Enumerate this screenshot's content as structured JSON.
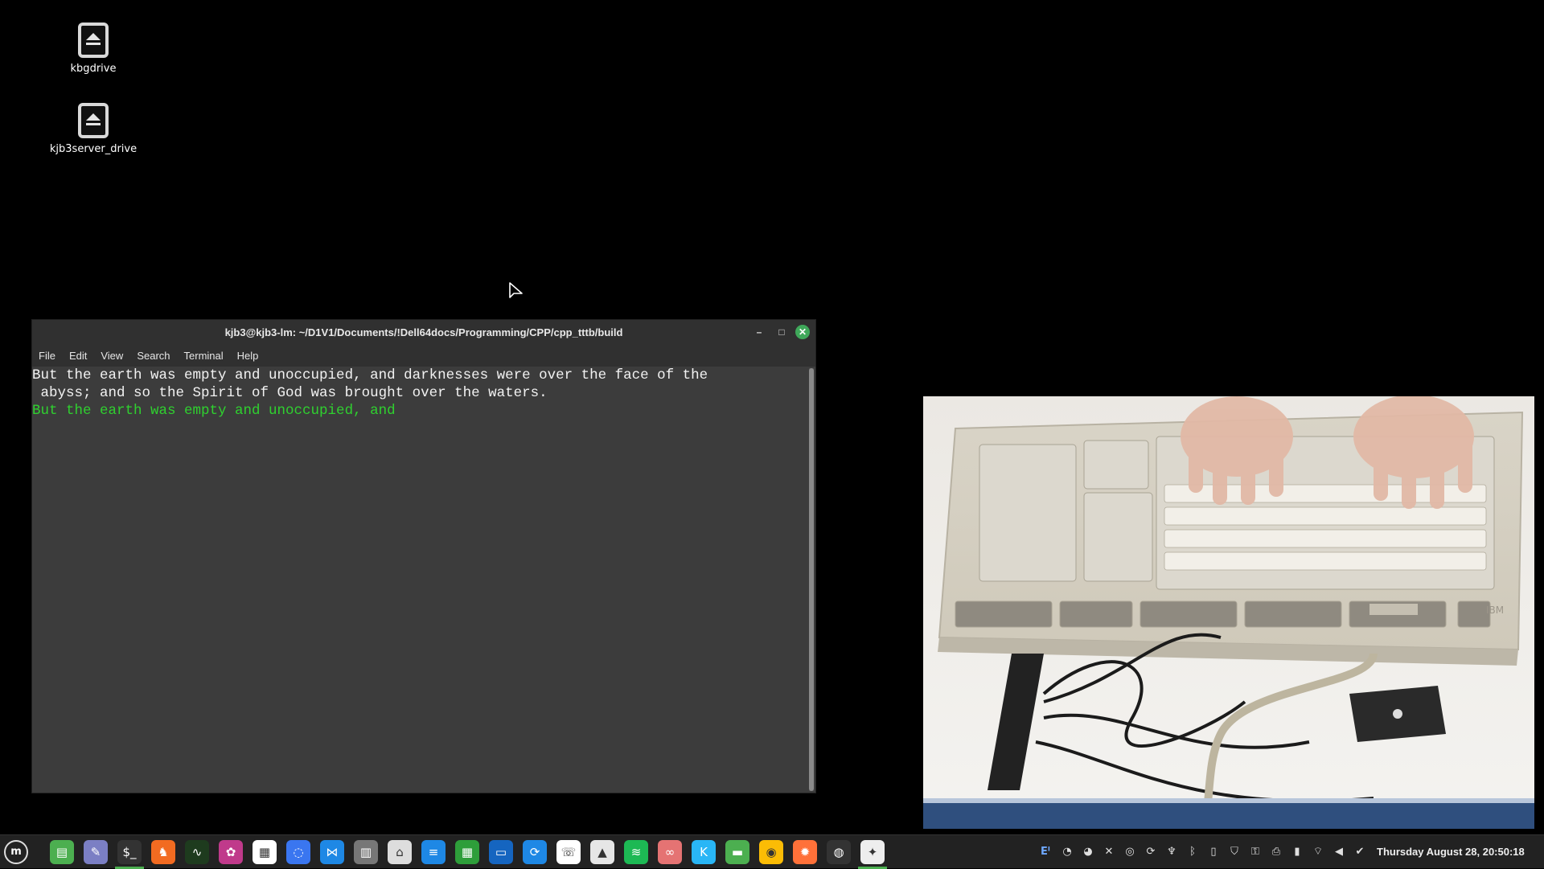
{
  "desktop": {
    "icons": [
      {
        "label": "kbgdrive",
        "icon": "drive-eject-icon"
      },
      {
        "label": "kjb3server_drive",
        "icon": "drive-eject-icon"
      }
    ]
  },
  "terminal": {
    "title": "kjb3@kjb3-lm: ~/D1V1/Documents/!Dell64docs/Programming/CPP/cpp_tttb/build",
    "menu": [
      "File",
      "Edit",
      "View",
      "Search",
      "Terminal",
      "Help"
    ],
    "lines": [
      {
        "text": "But the earth was empty and unoccupied, and darknesses were over the face of the",
        "color": "#f2f2f2"
      },
      {
        "text": " abyss; and so the Spirit of God was brought over the waters.",
        "color": "#f2f2f2"
      },
      {
        "text": "But the earth was empty and unoccupied, and",
        "color": "#2fd02f"
      }
    ]
  },
  "webcam": {
    "badge_text": "IBM"
  },
  "taskbar": {
    "menu_icon": "mint-menu-icon",
    "apps": [
      {
        "name": "files-icon",
        "color": "#4caf50"
      },
      {
        "name": "text-editor-icon",
        "color": "#7b7fc4"
      },
      {
        "name": "terminal-icon",
        "color": "#333333"
      },
      {
        "name": "brave-icon",
        "color": "#f26b21"
      },
      {
        "name": "system-monitor-icon",
        "color": "#1e3b1e"
      },
      {
        "name": "krita-icon",
        "color": "#c03a8b"
      },
      {
        "name": "calendar-icon",
        "color": "#ffffff"
      },
      {
        "name": "signal-icon",
        "color": "#3a76f0"
      },
      {
        "name": "vscode-icon",
        "color": "#1e88e5"
      },
      {
        "name": "archive-icon",
        "color": "#777777"
      },
      {
        "name": "jar-icon",
        "color": "#dddddd"
      },
      {
        "name": "writer-icon",
        "color": "#1e88e5"
      },
      {
        "name": "calc-icon",
        "color": "#2e9e3a"
      },
      {
        "name": "file-manager-icon",
        "color": "#1565c0"
      },
      {
        "name": "sync-icon",
        "color": "#1e88e5"
      },
      {
        "name": "whatsapp-icon",
        "color": "#ffffff"
      },
      {
        "name": "inkscape-icon",
        "color": "#e6e6e6"
      },
      {
        "name": "spotify-icon",
        "color": "#1db954"
      },
      {
        "name": "glasses-icon",
        "color": "#e57373"
      },
      {
        "name": "kdenlive-icon",
        "color": "#29b6f6"
      },
      {
        "name": "folder-icon",
        "color": "#4caf50"
      },
      {
        "name": "chrome-icon",
        "color": "#fbbc05"
      },
      {
        "name": "firefox-icon",
        "color": "#ff7139"
      },
      {
        "name": "obs-icon",
        "color": "#333333"
      },
      {
        "name": "tux-app-icon",
        "color": "#eeeeee"
      }
    ],
    "tray": [
      "keyboard-layout-icon",
      "notes-icon",
      "accessibility-icon",
      "obs-tray-icon",
      "sync-tray-icon",
      "cat-icon",
      "bluetooth-icon",
      "clipboard-icon",
      "shield-icon",
      "vpn-icon",
      "printer-icon",
      "battery-icon",
      "wifi-icon",
      "volume-icon",
      "update-icon"
    ],
    "tray_text": "Eᴵ",
    "clock": "Thursday August 28, 20:50:18"
  }
}
